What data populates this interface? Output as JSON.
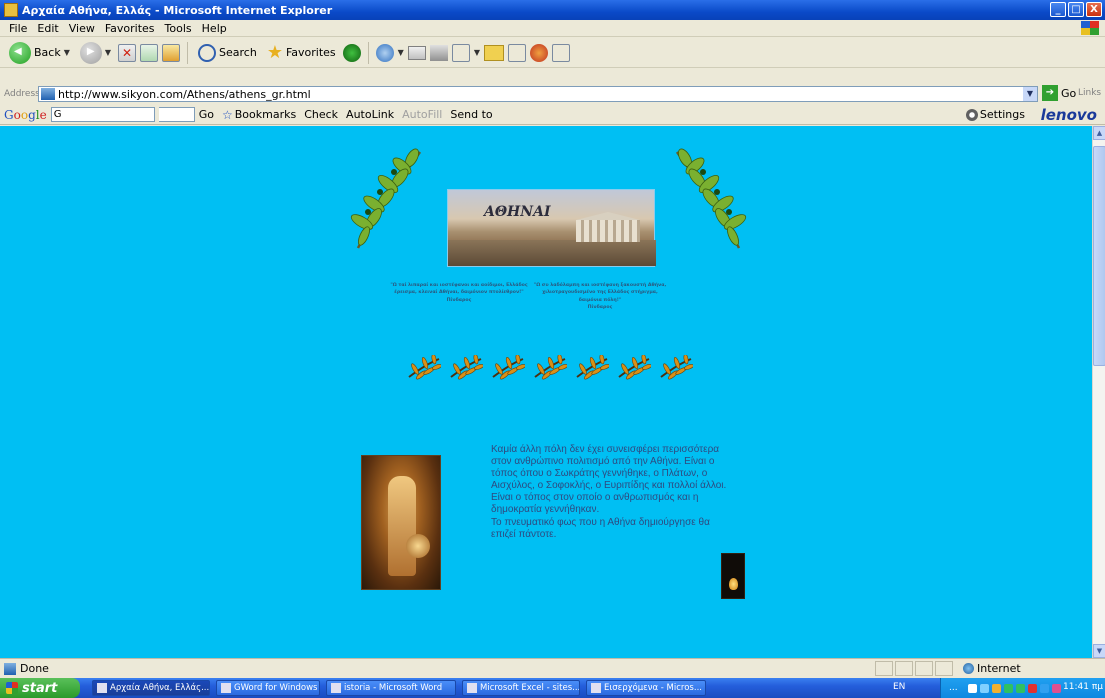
{
  "window": {
    "title": "Αρχαία Αθήνα, Ελλάς - Microsoft Internet Explorer",
    "min": "_",
    "max": "□",
    "close": "X"
  },
  "menu": [
    "File",
    "Edit",
    "View",
    "Favorites",
    "Tools",
    "Help"
  ],
  "toolbar": {
    "back": "Back",
    "search": "Search",
    "favorites": "Favorites"
  },
  "address": {
    "label": "Address",
    "url": "http://www.sikyon.com/Athens/athens_gr.html",
    "go": "Go",
    "links": "Links"
  },
  "google": {
    "logo": [
      "G",
      "o",
      "o",
      "g",
      "l",
      "e"
    ],
    "field": "G",
    "go": "Go",
    "bookmarks": "Bookmarks",
    "check": "Check",
    "autolink": "AutoLink",
    "autofill": "AutoFill",
    "sendto": "Send to",
    "settings": "Settings",
    "brand": "lenovo"
  },
  "page": {
    "banner_title": "ΑΘΗΝΑΙ",
    "quote_left": "\"Ω ταί λιπαραί και ιοστέφανοι και αοίδιμοι, Ελλάδος έρεισμα, κλειναί Αθήναι, δαιμόνιον πτολίεθρον!\"",
    "quote_left_author": "Πίνδαρος",
    "quote_right": "\"Ω συ λαδόλαμπη και ιοστέφανη ξακουστή Αθήνα, χιλιοτραγουδισμένο της Ελλάδος στήριγμα, δαιμόνια πόλη!\"",
    "quote_right_author": "Πίνδαρος",
    "paragraphs": [
      "Καμία άλλη πόλη δεν έχει συνεισφέρει περισσότερα στον ανθρώπινο πολιτισμό από την Αθήνα. Είναι ο τόπος όπου ο Σωκράτης γεννήθηκε, ο Πλάτων, ο Αισχύλος, ο Σοφοκλής, ο Ευριπίδης και πολλοί άλλοι.",
      "Είναι ο τόπος στον οποίο ο ανθρωπισμός και η δημοκρατία γεννήθηκαν.",
      "Το πνευματικό φως που η Αθήνα δημιούργησε θα επιζεί πάντοτε."
    ],
    "background_color": "#00bff3",
    "text_color": "#2e4a80"
  },
  "status": {
    "text": "Done",
    "zone": "Internet"
  },
  "taskbar": {
    "start": "start",
    "tasks": [
      "Αρχαία Αθήνα, Ελλάς...",
      "GWord for Windows",
      "istoria - Microsoft Word",
      "Microsoft Excel - sites...",
      "Εισερχόμενα - Micros..."
    ],
    "lang": "EN",
    "tray_dots": "...",
    "clock": "11:41 πμ"
  }
}
